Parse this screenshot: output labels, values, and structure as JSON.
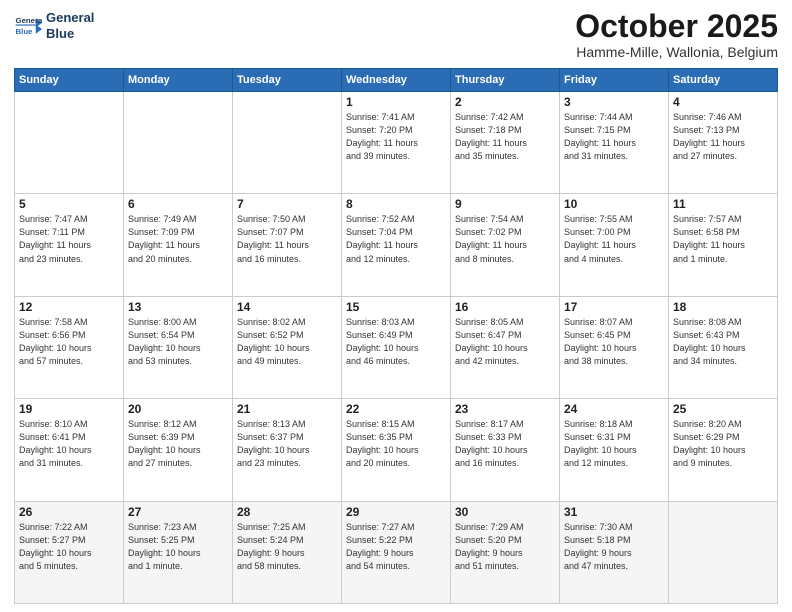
{
  "header": {
    "logo_line1": "General",
    "logo_line2": "Blue",
    "month": "October 2025",
    "location": "Hamme-Mille, Wallonia, Belgium"
  },
  "days_of_week": [
    "Sunday",
    "Monday",
    "Tuesday",
    "Wednesday",
    "Thursday",
    "Friday",
    "Saturday"
  ],
  "weeks": [
    [
      {
        "day": "",
        "info": ""
      },
      {
        "day": "",
        "info": ""
      },
      {
        "day": "",
        "info": ""
      },
      {
        "day": "1",
        "info": "Sunrise: 7:41 AM\nSunset: 7:20 PM\nDaylight: 11 hours\nand 39 minutes."
      },
      {
        "day": "2",
        "info": "Sunrise: 7:42 AM\nSunset: 7:18 PM\nDaylight: 11 hours\nand 35 minutes."
      },
      {
        "day": "3",
        "info": "Sunrise: 7:44 AM\nSunset: 7:15 PM\nDaylight: 11 hours\nand 31 minutes."
      },
      {
        "day": "4",
        "info": "Sunrise: 7:46 AM\nSunset: 7:13 PM\nDaylight: 11 hours\nand 27 minutes."
      }
    ],
    [
      {
        "day": "5",
        "info": "Sunrise: 7:47 AM\nSunset: 7:11 PM\nDaylight: 11 hours\nand 23 minutes."
      },
      {
        "day": "6",
        "info": "Sunrise: 7:49 AM\nSunset: 7:09 PM\nDaylight: 11 hours\nand 20 minutes."
      },
      {
        "day": "7",
        "info": "Sunrise: 7:50 AM\nSunset: 7:07 PM\nDaylight: 11 hours\nand 16 minutes."
      },
      {
        "day": "8",
        "info": "Sunrise: 7:52 AM\nSunset: 7:04 PM\nDaylight: 11 hours\nand 12 minutes."
      },
      {
        "day": "9",
        "info": "Sunrise: 7:54 AM\nSunset: 7:02 PM\nDaylight: 11 hours\nand 8 minutes."
      },
      {
        "day": "10",
        "info": "Sunrise: 7:55 AM\nSunset: 7:00 PM\nDaylight: 11 hours\nand 4 minutes."
      },
      {
        "day": "11",
        "info": "Sunrise: 7:57 AM\nSunset: 6:58 PM\nDaylight: 11 hours\nand 1 minute."
      }
    ],
    [
      {
        "day": "12",
        "info": "Sunrise: 7:58 AM\nSunset: 6:56 PM\nDaylight: 10 hours\nand 57 minutes."
      },
      {
        "day": "13",
        "info": "Sunrise: 8:00 AM\nSunset: 6:54 PM\nDaylight: 10 hours\nand 53 minutes."
      },
      {
        "day": "14",
        "info": "Sunrise: 8:02 AM\nSunset: 6:52 PM\nDaylight: 10 hours\nand 49 minutes."
      },
      {
        "day": "15",
        "info": "Sunrise: 8:03 AM\nSunset: 6:49 PM\nDaylight: 10 hours\nand 46 minutes."
      },
      {
        "day": "16",
        "info": "Sunrise: 8:05 AM\nSunset: 6:47 PM\nDaylight: 10 hours\nand 42 minutes."
      },
      {
        "day": "17",
        "info": "Sunrise: 8:07 AM\nSunset: 6:45 PM\nDaylight: 10 hours\nand 38 minutes."
      },
      {
        "day": "18",
        "info": "Sunrise: 8:08 AM\nSunset: 6:43 PM\nDaylight: 10 hours\nand 34 minutes."
      }
    ],
    [
      {
        "day": "19",
        "info": "Sunrise: 8:10 AM\nSunset: 6:41 PM\nDaylight: 10 hours\nand 31 minutes."
      },
      {
        "day": "20",
        "info": "Sunrise: 8:12 AM\nSunset: 6:39 PM\nDaylight: 10 hours\nand 27 minutes."
      },
      {
        "day": "21",
        "info": "Sunrise: 8:13 AM\nSunset: 6:37 PM\nDaylight: 10 hours\nand 23 minutes."
      },
      {
        "day": "22",
        "info": "Sunrise: 8:15 AM\nSunset: 6:35 PM\nDaylight: 10 hours\nand 20 minutes."
      },
      {
        "day": "23",
        "info": "Sunrise: 8:17 AM\nSunset: 6:33 PM\nDaylight: 10 hours\nand 16 minutes."
      },
      {
        "day": "24",
        "info": "Sunrise: 8:18 AM\nSunset: 6:31 PM\nDaylight: 10 hours\nand 12 minutes."
      },
      {
        "day": "25",
        "info": "Sunrise: 8:20 AM\nSunset: 6:29 PM\nDaylight: 10 hours\nand 9 minutes."
      }
    ],
    [
      {
        "day": "26",
        "info": "Sunrise: 7:22 AM\nSunset: 5:27 PM\nDaylight: 10 hours\nand 5 minutes."
      },
      {
        "day": "27",
        "info": "Sunrise: 7:23 AM\nSunset: 5:25 PM\nDaylight: 10 hours\nand 1 minute."
      },
      {
        "day": "28",
        "info": "Sunrise: 7:25 AM\nSunset: 5:24 PM\nDaylight: 9 hours\nand 58 minutes."
      },
      {
        "day": "29",
        "info": "Sunrise: 7:27 AM\nSunset: 5:22 PM\nDaylight: 9 hours\nand 54 minutes."
      },
      {
        "day": "30",
        "info": "Sunrise: 7:29 AM\nSunset: 5:20 PM\nDaylight: 9 hours\nand 51 minutes."
      },
      {
        "day": "31",
        "info": "Sunrise: 7:30 AM\nSunset: 5:18 PM\nDaylight: 9 hours\nand 47 minutes."
      },
      {
        "day": "",
        "info": ""
      }
    ]
  ]
}
